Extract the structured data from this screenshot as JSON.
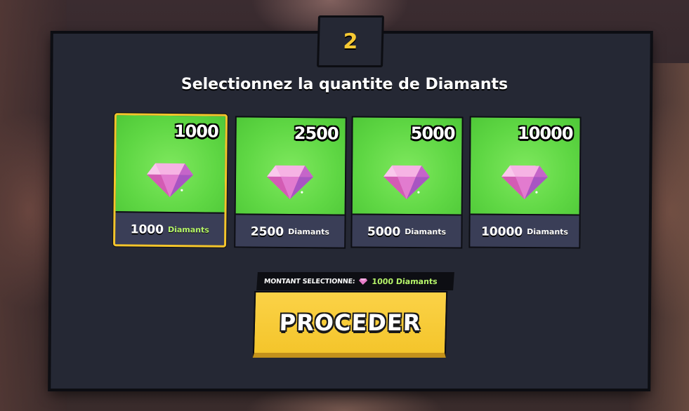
{
  "step": {
    "number": "2"
  },
  "title": "Selectionnez la quantite de Diamants",
  "packages": [
    {
      "amount": "1000",
      "label_number": "1000",
      "label_unit": "Diamants",
      "selected": true
    },
    {
      "amount": "2500",
      "label_number": "2500",
      "label_unit": "Diamants",
      "selected": false
    },
    {
      "amount": "5000",
      "label_number": "5000",
      "label_unit": "Diamants",
      "selected": false
    },
    {
      "amount": "10000",
      "label_number": "10000",
      "label_unit": "Diamants",
      "selected": false
    }
  ],
  "selection": {
    "label": "MONTANT SELECTIONNE:",
    "value": "1000 Diamants",
    "icon": "diamond-icon"
  },
  "proceed_button": {
    "label": "PROCEDER"
  },
  "colors": {
    "accent_yellow": "#f4c52b",
    "card_green": "#5fd744",
    "panel": "#252834",
    "highlight_green": "#b6f56a"
  }
}
